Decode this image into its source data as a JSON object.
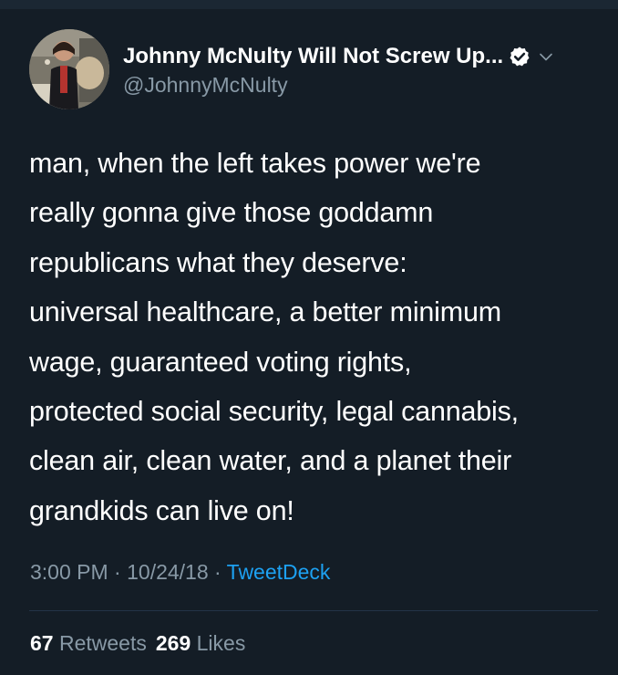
{
  "colors": {
    "background": "#141d26",
    "text_primary": "#ffffff",
    "text_secondary": "#8899a6",
    "link": "#1da1f2",
    "divider": "#243447"
  },
  "author": {
    "display_name": "Johnny McNulty Will Not Screw Up...",
    "handle": "@JohnnyMcNulty",
    "verified": true,
    "avatar_icon": "profile-photo",
    "menu_icon": "chevron-down-icon"
  },
  "tweet": {
    "lines": [
      "man, when the left takes power we're",
      "really gonna give those goddamn",
      "republicans what they deserve:",
      "universal healthcare, a better minimum",
      "wage, guaranteed voting rights,",
      "protected social security, legal cannabis,",
      "clean air, clean water, and a planet their",
      "grandkids can live on!"
    ]
  },
  "meta": {
    "time": "3:00 PM",
    "separator": " · ",
    "date": "10/24/18",
    "source": "TweetDeck"
  },
  "stats": {
    "retweets_count": "67",
    "retweets_label": "Retweets",
    "likes_count": "269",
    "likes_label": "Likes"
  }
}
